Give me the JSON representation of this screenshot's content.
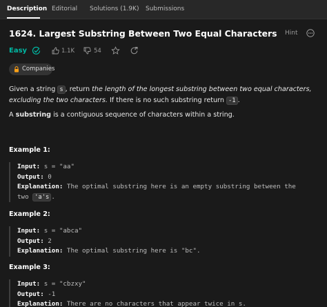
{
  "tabs": [
    {
      "label": "Description",
      "active": true
    },
    {
      "label": "Editorial",
      "active": false
    },
    {
      "label": "Solutions (1.9K)",
      "active": false
    },
    {
      "label": "Submissions",
      "active": false
    }
  ],
  "problem": {
    "title": "1624. Largest Substring Between Two Equal Characters",
    "hint_label": "Hint",
    "difficulty": "Easy",
    "likes": "1.1K",
    "dislikes": "54",
    "companies_label": "Companies"
  },
  "description": {
    "p1_a": "Given a string ",
    "p1_code1": "s",
    "p1_b": ", return ",
    "p1_italic": "the length of the longest substring between two equal characters, excluding the two characters.",
    "p1_c": " If there is no such substring return ",
    "p1_code2": "-1",
    "p1_d": ".",
    "p2_bold": "substring",
    "p2_a": "A ",
    "p2_b": " is a contiguous sequence of characters within a string."
  },
  "examples": [
    {
      "heading": "Example 1:",
      "input_label": "Input:",
      "input": " s = \"aa\"",
      "output_label": "Output:",
      "output": " 0",
      "expl_label": "Explanation:",
      "expl": " The optimal substring here is an empty substring between the",
      "expl_cont_a": "two ",
      "expl_cont_code": "'a's",
      "expl_cont_b": "."
    },
    {
      "heading": "Example 2:",
      "input_label": "Input:",
      "input": " s = \"abca\"",
      "output_label": "Output:",
      "output": " 2",
      "expl_label": "Explanation:",
      "expl": " The optimal substring here is \"bc\"."
    },
    {
      "heading": "Example 3:",
      "input_label": "Input:",
      "input": " s = \"cbzxy\"",
      "output_label": "Output:",
      "output": " -1",
      "expl_label": "Explanation:",
      "expl": " There are no characters that appear twice in s."
    }
  ],
  "colors": {
    "easy": "#00b8a3",
    "background": "#1a1a1a",
    "tabbar": "#282828"
  }
}
